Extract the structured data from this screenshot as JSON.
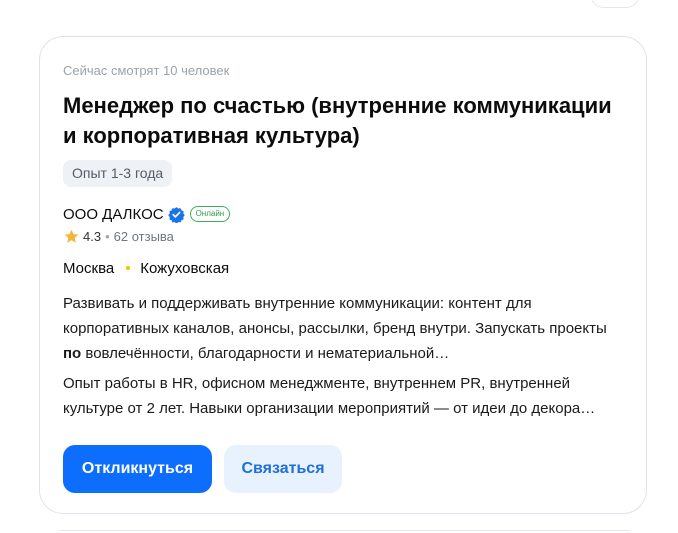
{
  "vacancy": {
    "watching": "Сейчас смотрят 10 человек",
    "title": "Менеджер по счастью (внутренние коммуникации и корпоративная культура)",
    "experience": "Опыт 1-3 года",
    "company": {
      "name": "ООО ДАЛКОС",
      "verified_icon": "verified-check-icon",
      "online_badge": "Онлайн",
      "rating": "4.3",
      "separator": "•",
      "reviews": "62 отзыва"
    },
    "location": {
      "city": "Москва",
      "metro": "Кожуховская",
      "metro_color": "#f2c200"
    },
    "description": {
      "part1_before": "Развивать и поддерживать внутренние коммуникации: контент для корпоративных каналов, анонсы, рассылки, бренд внутри. Запускать проекты ",
      "part1_bold": "по",
      "part1_after": " вовлечённости, благодарности и нематериальной…",
      "part2": "Опыт работы в HR, офисном менеджменте, внутреннем PR, внутренней культуре от 2 лет. Навыки организации мероприятий — от идеи до декора…"
    },
    "actions": {
      "respond": "Откликнуться",
      "contact": "Связаться"
    }
  },
  "colors": {
    "primary": "#0d6efd",
    "secondary_bg": "#e8f2fe",
    "online_green": "#2e9f4b",
    "star": "#f5b638"
  }
}
